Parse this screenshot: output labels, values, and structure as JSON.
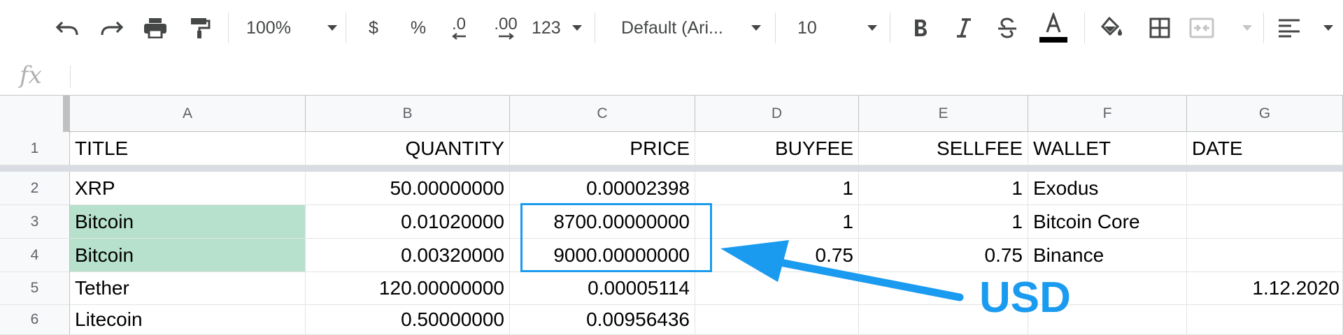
{
  "toolbar": {
    "zoom": "100%",
    "currency": "$",
    "percent": "%",
    "decrease_decimal": ".0",
    "increase_decimal": ".00",
    "more_formats": "123",
    "font": "Default (Ari...",
    "font_size": "10"
  },
  "formula_bar": {
    "fx": "fx",
    "content": ""
  },
  "columns": [
    "A",
    "B",
    "C",
    "D",
    "E",
    "F",
    "G"
  ],
  "rows": [
    {
      "num": "1",
      "cells": [
        "TITLE",
        "QUANTITY",
        "PRICE",
        "BUYFEE",
        "SELLFEE",
        "WALLET",
        "DATE"
      ]
    },
    {
      "num": "2",
      "cells": [
        "XRP",
        "50.00000000",
        "0.00002398",
        "1",
        "1",
        "Exodus",
        ""
      ]
    },
    {
      "num": "3",
      "cells": [
        "Bitcoin",
        "0.01020000",
        "8700.00000000",
        "1",
        "1",
        "Bitcoin Core",
        ""
      ]
    },
    {
      "num": "4",
      "cells": [
        "Bitcoin",
        "0.00320000",
        "9000.00000000",
        "0.75",
        "0.75",
        "Binance",
        ""
      ]
    },
    {
      "num": "5",
      "cells": [
        "Tether",
        "120.00000000",
        "0.00005114",
        "",
        "",
        "",
        "1.12.2020"
      ]
    },
    {
      "num": "6",
      "cells": [
        "Litecoin",
        "0.50000000",
        "0.00956436",
        "",
        "",
        "",
        ""
      ]
    }
  ],
  "annotation": {
    "label": "USD",
    "color": "#1a9bf0"
  },
  "colors": {
    "selection_green": "#b7e1cd",
    "header_bg": "#f8f9fa"
  }
}
